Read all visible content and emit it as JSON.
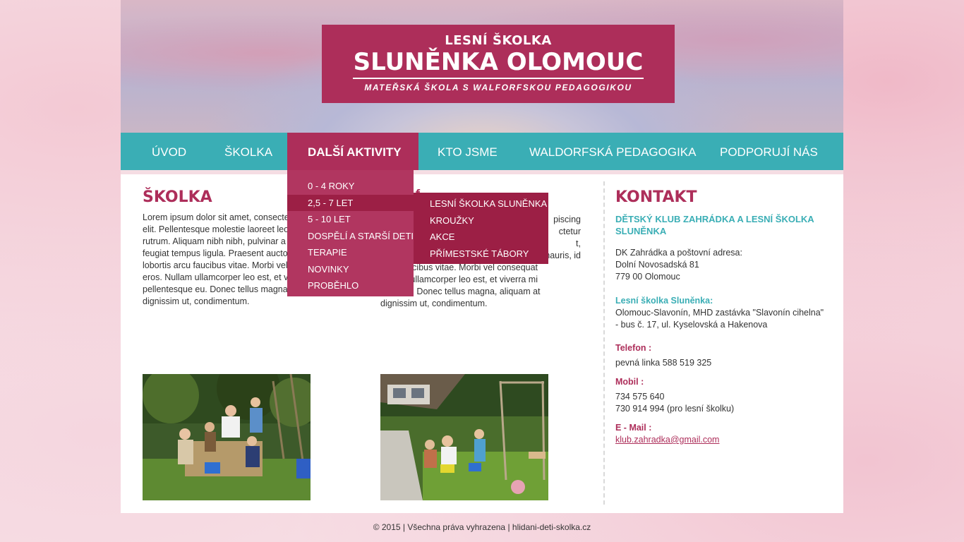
{
  "header": {
    "line1": "LESNÍ ŠKOLKA",
    "line2": "SLUNĚNKA OLOMOUC",
    "line3": "MATEŘSKÁ ŠKOLA S WALFORFSKOU PEDAGOGIKOU"
  },
  "nav": {
    "items": [
      {
        "label": "ÚVOD"
      },
      {
        "label": "ŠKOLKA"
      },
      {
        "label": "DALŠÍ AKTIVITY"
      },
      {
        "label": "KTO JSME"
      },
      {
        "label": "WALDORFSKÁ PEDAGOGIKA"
      },
      {
        "label": "PODPORUJÍ NÁS"
      }
    ]
  },
  "dropdown": {
    "items": [
      "0 - 4 ROKY",
      "2,5 - 7 LET",
      "5 - 10 LET",
      "DOSPĚLÍ A STARŠÍ DETI",
      "TERAPIE",
      "NOVINKY",
      "PROBĚHLO"
    ],
    "submenu": [
      "LESNÍ ŠKOLKA SLUNĚNKA",
      "KROUŽKY",
      "AKCE",
      "PŘÍMESTSKÉ TÁBORY"
    ]
  },
  "main": {
    "col1": {
      "title": "ŠKOLKA",
      "lines": [
        "Lorem ipsum dolor sit amet, consectet",
        "elit. Pellentesque molestie laoreet leo",
        "rutrum. Aliquam nibh nibh, pulvinar a",
        "feugiat tempus ligula. Praesent auctor",
        "lobortis arcu faucibus vitae. Morbi vel",
        "eros. Nullam ullamcorper leo est, et viv",
        "pellentesque eu. Donec tellus magna,",
        "dignissim ut, condimentum."
      ]
    },
    "col2": {
      "title_fragment": "f",
      "right_fragments": [
        "piscing",
        "ctetur",
        "t,",
        "mauris, id"
      ],
      "lines": [
        "arcu faucibus vitae. Morbi vel consequat",
        "Nullam ullamcorper leo est, et viverra mi",
        "sque eu. Donec tellus magna, aliquam at",
        "dignissim ut, condimentum."
      ]
    }
  },
  "contact": {
    "title": "KONTAKT",
    "subtitle": "DĚTSKÝ KLUB ZAHRÁDKA A LESNÍ ŠKOLKA SLUNĚNKA",
    "address_lines": [
      "DK Zahrádka a poštovní adresa:",
      "Dolní Novosadská 81",
      "779 00 Olomouc"
    ],
    "lesni_label": "Lesní školka Sluněnka:",
    "lesni_lines": [
      "Olomouc-Slavonín, MHD zastávka \"Slavonín cihelna\"",
      "- bus č. 17, ul. Kyselovská a Hakenova"
    ],
    "phone_label": "Telefon :",
    "phone": "pevná linka 588 519 325",
    "mobile_label": "Mobil :",
    "mobile_lines": [
      "734 575 640",
      "730 914 994 (pro lesní školku)"
    ],
    "email_label": "E - Mail :",
    "email": "klub.zahradka@gmail.com"
  },
  "footer": {
    "text": "© 2015 | Všechna práva vyhrazena | hlidani-deti-skolka.cz"
  }
}
